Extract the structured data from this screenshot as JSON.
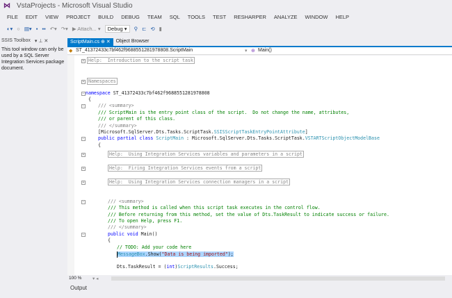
{
  "window": {
    "title": "VstaProjects - Microsoft Visual Studio"
  },
  "menu": [
    "FILE",
    "EDIT",
    "VIEW",
    "PROJECT",
    "BUILD",
    "DEBUG",
    "TEAM",
    "SQL",
    "TOOLS",
    "TEST",
    "RESHARPER",
    "ANALYZE",
    "WINDOW",
    "HELP"
  ],
  "toolbar": {
    "attach": "▶ Attach... ▾",
    "config": "Debug ▾"
  },
  "left_panel": {
    "title": "SSIS Toolbox",
    "controls": "▾ ⊥ ✕",
    "text": "This tool window can only be used by a SQL Server Integration Services package document."
  },
  "tabs": [
    {
      "label": "ScriptMain.cs ⊕ ✕"
    },
    {
      "label": "Object Browser"
    }
  ],
  "navbar": {
    "class": "ST_41372433c7bf462f9688551281978808.ScriptMain",
    "member": "Main()"
  },
  "code": {
    "help_intro": "Help:  Introduction to the script task",
    "namespaces": "Namespaces",
    "ns_kw": "namespace",
    "ns_name": " ST_41372433c7bf462f9688551281978808",
    "brace_open": "{",
    "c1": "/// <summary>",
    "c2": "/// ScriptMain is the entry point class of the script.  Do not change the name, attributes,",
    "c3": "/// or parent of this class.",
    "c4": "/// </summary>",
    "attr_a": "[Microsoft.SqlServer.Dts.Tasks.ScriptTask.",
    "attr_b": "SSISScriptTaskEntryPointAttribute",
    "attr_c": "]",
    "cls_kw": "public partial class ",
    "cls_name": "ScriptMain",
    "cls_mid": " : Microsoft.SqlServer.Dts.Tasks.ScriptTask.",
    "cls_base": "VSTARTScriptObjectModelBase",
    "help1": "Help:  Using Integration Services variables and parameters in a script",
    "help2": "Help:  Firing Integration Services events from a script",
    "help3": "Help:  Using Integration Services connection managers in a script",
    "m1": "/// <summary>",
    "m2": "/// This method is called when this script task executes in the control flow.",
    "m3": "/// Before returning from this method, set the value of Dts.TaskResult to indicate success or failure.",
    "m4": "/// To open Help, press F1.",
    "m5": "/// </summary>",
    "main_kw": "public void ",
    "main_name": "Main()",
    "todo": "// TODO: Add your code here",
    "mb_type": "MessageBox",
    "mb_call": ".Show(",
    "mb_str": "\"Data is being imported\"",
    "mb_end": ");",
    "dts_a": "Dts.TaskResult = (",
    "dts_kw": "int",
    "dts_b": ")",
    "dts_type": "ScriptResults",
    "dts_c": ".Success;"
  },
  "status": {
    "zoom": "100 %"
  },
  "output": {
    "title": "Output"
  }
}
